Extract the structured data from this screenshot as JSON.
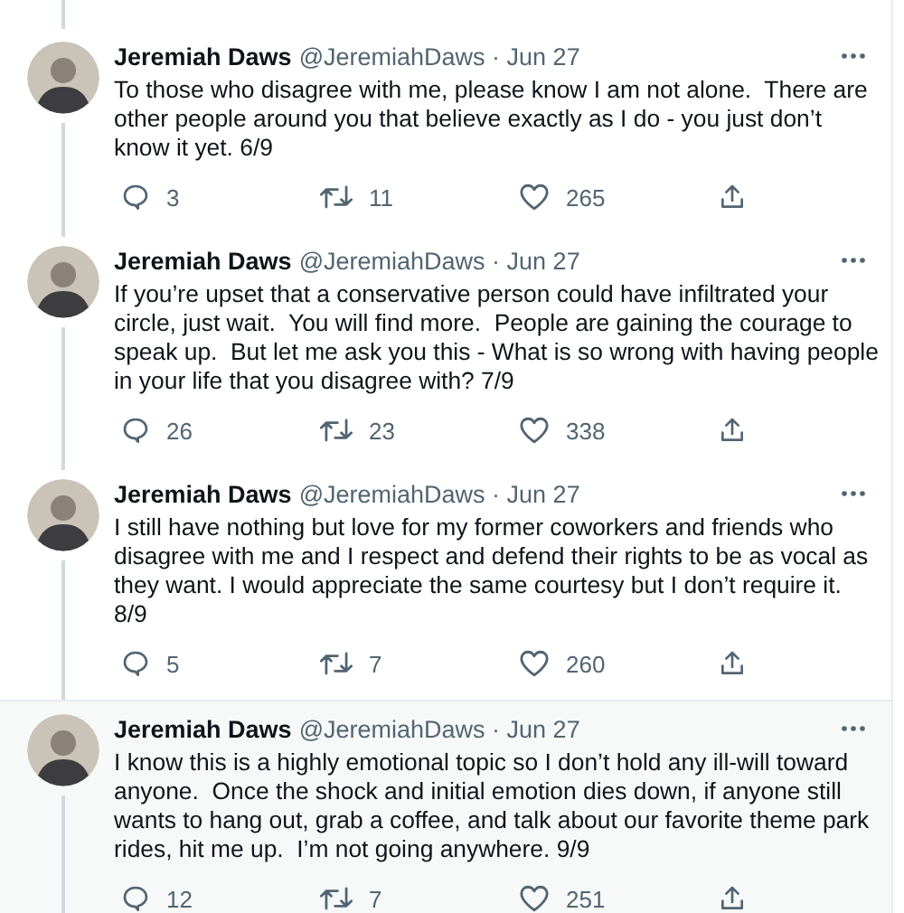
{
  "tweets": [
    {
      "name": "Jeremiah Daws",
      "meta": "@JeremiahDaws · Jun 27",
      "text": "To those who disagree with me, please know I am not alone.  There are other people around you that believe exactly as I do - you just don’t know it yet. 6/9",
      "replies": "3",
      "retweets": "11",
      "likes": "265",
      "highlighted": false
    },
    {
      "name": "Jeremiah Daws",
      "meta": "@JeremiahDaws · Jun 27",
      "text": "If you’re upset that a conservative person could have infiltrated your circle, just wait.  You will find more.  People are gaining the courage to speak up.  But let me ask you this - What is so wrong with having people in your life that you disagree with? 7/9",
      "replies": "26",
      "retweets": "23",
      "likes": "338",
      "highlighted": false
    },
    {
      "name": "Jeremiah Daws",
      "meta": "@JeremiahDaws · Jun 27",
      "text": "I still have nothing but love for my former coworkers and friends who disagree with me and I respect and defend their rights to be as vocal as they want. I would appreciate the same courtesy but I don’t require it. 8/9",
      "replies": "5",
      "retweets": "7",
      "likes": "260",
      "highlighted": false
    },
    {
      "name": "Jeremiah Daws",
      "meta": "@JeremiahDaws · Jun 27",
      "text": "I know this is a highly emotional topic so I don’t hold any ill-will toward anyone.  Once the shock and initial emotion dies down, if anyone still wants to hang out, grab a coffee, and talk about our favorite theme park rides, hit me up.  I’m not going anywhere. 9/9",
      "replies": "12",
      "retweets": "7",
      "likes": "251",
      "highlighted": true
    }
  ]
}
